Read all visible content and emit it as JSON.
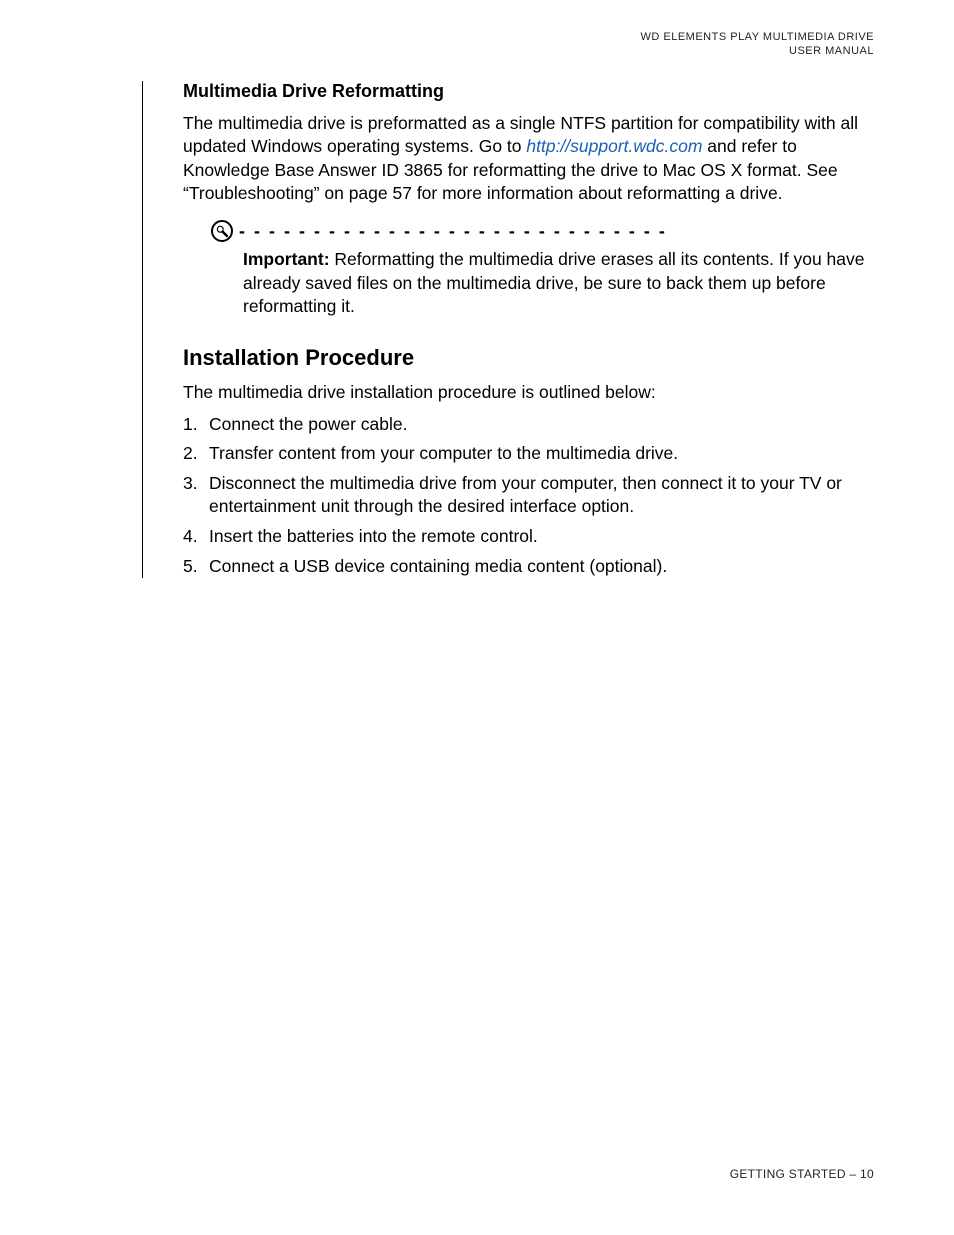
{
  "header": {
    "line1": "WD ELEMENTS PLAY MULTIMEDIA DRIVE",
    "line2": "USER MANUAL"
  },
  "section_reformat": {
    "heading": "Multimedia Drive Reformatting",
    "para_pre": "The multimedia drive is preformatted as a single NTFS partition for compatibility with all updated Windows operating systems. Go to ",
    "link_text": "http://support.wdc.com",
    "para_post": " and refer to Knowledge Base Answer ID 3865 for reformatting the drive to Mac OS X format. See “Troubleshooting” on page 57 for more information about reformatting a drive."
  },
  "important": {
    "label": "Important:",
    "text": " Reformatting the multimedia drive erases all its contents. If you have already saved files on the multimedia drive, be sure to back them up before reformatting it."
  },
  "section_install": {
    "heading": "Installation Procedure",
    "intro": "The multimedia drive installation procedure is outlined below:",
    "steps": [
      "Connect the power cable.",
      "Transfer content from your computer to the multimedia drive.",
      "Disconnect the multimedia drive from your computer, then connect it to your TV or entertainment unit through the desired interface option.",
      "Insert the batteries into the remote control.",
      "Connect a USB device containing media content (optional)."
    ]
  },
  "footer": {
    "section": "GETTING STARTED",
    "separator": " – ",
    "page": "10"
  },
  "dots": "- - - - - - - - - - - - - - - - - - - - - - - - - - - - - - - - - - - - - - - - - - - - -"
}
